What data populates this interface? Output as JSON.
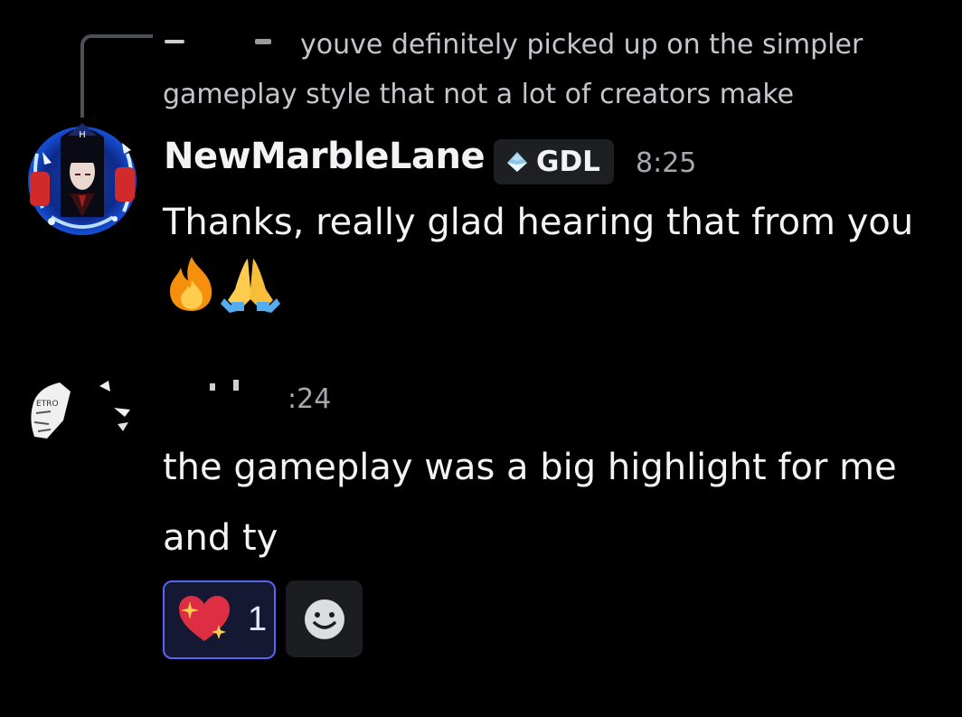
{
  "reply": {
    "text": "youve definitely picked up on the simpler gameplay style that not a lot of creators make"
  },
  "message1": {
    "username": "NewMarbleLane",
    "tag": "GDL",
    "timestamp": "8:25",
    "text": "Thanks, really glad hearing that from you",
    "emojis": [
      "fire-emoji",
      "folded-hands-emoji"
    ]
  },
  "message2": {
    "timestamp": ":24",
    "text": "the gameplay was a big highlight for me and ty"
  },
  "reactions": {
    "items": [
      {
        "emoji": "sparkling-heart-emoji",
        "count": "1",
        "selected": true
      }
    ],
    "add_icon": "smiley-add-reaction-icon"
  },
  "colors": {
    "background": "#000000",
    "reaction_border": "#5865f2",
    "reaction_bg": "#141833",
    "muted_text": "#a6a8ae"
  }
}
